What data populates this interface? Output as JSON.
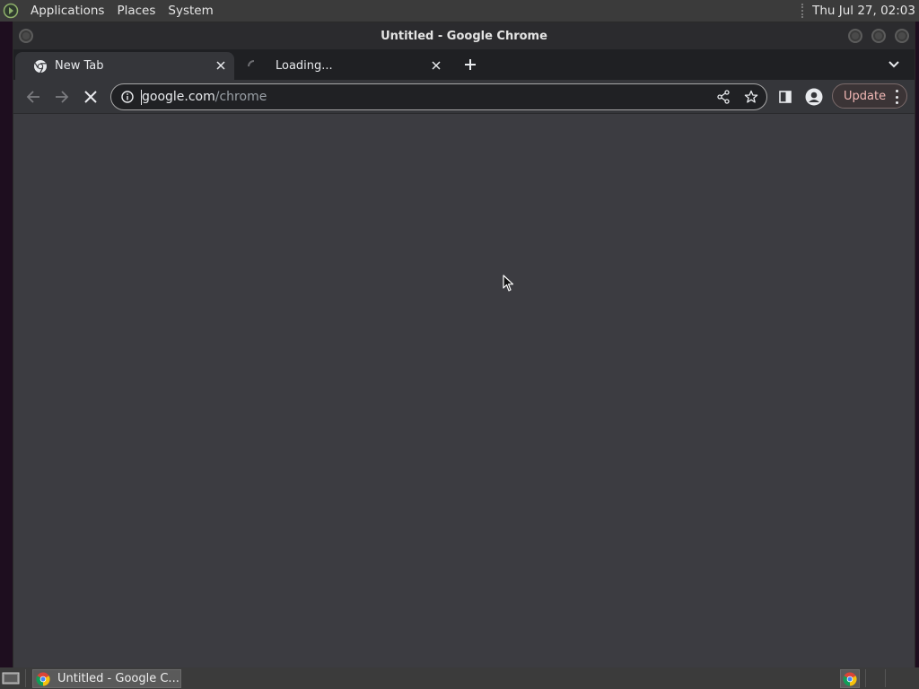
{
  "top_panel": {
    "menu_applications": "Applications",
    "menu_places": "Places",
    "menu_system": "System",
    "clock": "Thu Jul 27, 02:03"
  },
  "window": {
    "title": "Untitled - Google Chrome"
  },
  "tabs": [
    {
      "label": "New Tab",
      "icon": "chrome-icon",
      "active": true
    },
    {
      "label": "Loading...",
      "icon": "loading-spinner-icon",
      "active": false
    }
  ],
  "toolbar": {
    "url_domain": "google.com",
    "url_path": "/chrome",
    "update_label": "Update"
  },
  "taskbar": {
    "chrome_task_label": "Untitled - Google C..."
  },
  "colors": {
    "accent_update": "#f2b8b5",
    "content_bg": "#3c3c41",
    "panel_bg": "#3b3b3b"
  }
}
